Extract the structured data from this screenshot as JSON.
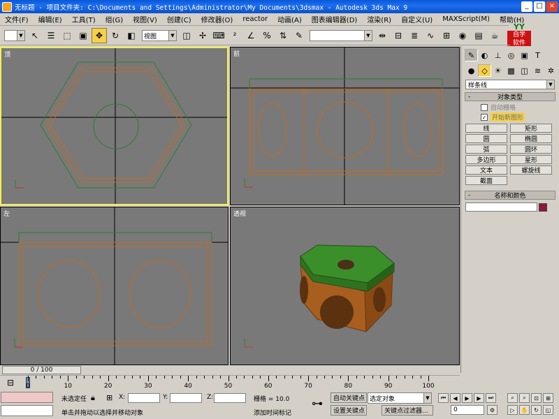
{
  "window": {
    "title": "无标题 - 项目文件夹: C:\\Documents and Settings\\Administrator\\My Documents\\3dsmax - Autodesk 3ds Max 9",
    "minimize_glyph": "_",
    "maximize_glyph": "□",
    "close_glyph": "×"
  },
  "menu": [
    "文件(F)",
    "编辑(E)",
    "工具(T)",
    "组(G)",
    "视图(V)",
    "创建(C)",
    "修改器(O)",
    "reactor",
    "动画(A)",
    "图表编辑器(D)",
    "渲染(R)",
    "自定义(U)",
    "MAXScript(M)",
    "帮助(H)"
  ],
  "logo": {
    "top": "YY",
    "line1": "自学",
    "line2": "软件"
  },
  "toolbar": {
    "selection_filter": "",
    "reference_coord": "视图",
    "named_selection": "",
    "icons": [
      "undo-icon",
      "redo-icon",
      "link-icon",
      "unlink-icon",
      "bind-space-warp-icon",
      "select-icon",
      "select-by-name-icon",
      "rect-selection-icon",
      "window-crossing-icon",
      "move-icon",
      "rotate-icon",
      "scale-icon"
    ]
  },
  "viewports": {
    "top": {
      "label": "顶"
    },
    "front": {
      "label": "前"
    },
    "left": {
      "label": "左"
    },
    "perspective": {
      "label": "透视"
    }
  },
  "command_panel": {
    "dropdown": "样条线",
    "rollout_object_type": "对象类型",
    "auto_grid_label": "自动栅格",
    "start_new_shape_label": "开始新图形",
    "start_new_shape_check": "✓",
    "objects": [
      "线",
      "矩形",
      "圆",
      "椭圆",
      "弧",
      "圆环",
      "多边形",
      "星形",
      "文本",
      "螺旋线",
      "截面"
    ],
    "rollout_name_color": "名称和颜色",
    "rollout_minus": "-",
    "rollout_plus": "+",
    "object_color": "#8b1a3a"
  },
  "timeline": {
    "frame_display": "0 / 100",
    "ticks": [
      0,
      10,
      20,
      30,
      40,
      50,
      60,
      70,
      80,
      90,
      100
    ]
  },
  "status": {
    "selection": "未选定任",
    "prompt": "单击并拖动以选择并移动对象",
    "x_label": "X:",
    "y_label": "Y:",
    "z_label": "Z:",
    "grid": "栅格 = 10.0",
    "add_time_tag": "添加时间标记",
    "auto_key": "自动关键点",
    "set_key": "设置关键点",
    "selected_object": "选定对象",
    "key_filters": "关键点过滤器...",
    "frame_input": "0"
  }
}
